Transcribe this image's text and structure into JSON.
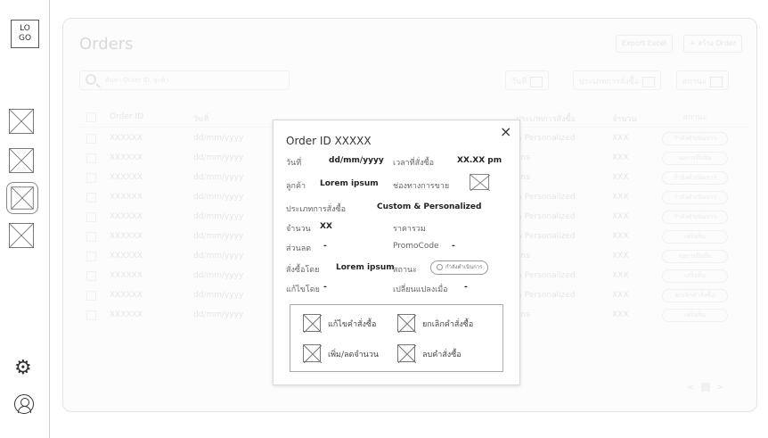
{
  "app": {
    "logo": "LO\nGO"
  },
  "sidebar": {
    "items": [
      {
        "icon": "placeholder-icon",
        "active": false
      },
      {
        "icon": "placeholder-icon",
        "active": false
      },
      {
        "icon": "placeholder-icon",
        "active": true
      },
      {
        "icon": "placeholder-icon",
        "active": false
      }
    ],
    "settings_icon": "gear-icon",
    "profile_icon": "user-icon"
  },
  "page": {
    "title": "Orders",
    "export_label": "Export Excel",
    "add_label": "+ สร้าง Order",
    "search_placeholder": "ค้นหา Order ID, ลูกค้า",
    "filters": [
      {
        "label": "วันที่"
      },
      {
        "label": "ประเภทการสั่งซื้อ"
      },
      {
        "label": "สถานะ"
      }
    ],
    "columns": {
      "id": "Order ID",
      "date": "วันที่",
      "type": "ประเภทการสั่งซื้อ",
      "qty": "จำนวน",
      "status": "สถานะ"
    },
    "rows": [
      {
        "id": "XXXXXX",
        "date": "dd/mm/yyyy",
        "type": "& Personalized",
        "qty": "XXX",
        "status": "กำลังดำเนินการ"
      },
      {
        "id": "XXXXXX",
        "date": "dd/mm/yyyy",
        "type": "ons",
        "qty": "XXX",
        "status": "รอการยืนยัน"
      },
      {
        "id": "XXXXXX",
        "date": "dd/mm/yyyy",
        "type": "ons",
        "qty": "XXX",
        "status": "กำลังดำเนินการ"
      },
      {
        "id": "XXXXXX",
        "date": "dd/mm/yyyy",
        "type": "& Personalized",
        "qty": "XXX",
        "status": "กำลังดำเนินการ"
      },
      {
        "id": "XXXXXX",
        "date": "dd/mm/yyyy",
        "type": "& Personalized",
        "qty": "XXX",
        "status": "กำลังดำเนินการ"
      },
      {
        "id": "XXXXXX",
        "date": "dd/mm/yyyy",
        "type": "& Personalized",
        "qty": "XXX",
        "status": "เสร็จสิ้น"
      },
      {
        "id": "XXXXXX",
        "date": "dd/mm/yyyy",
        "type": "ons",
        "qty": "XXX",
        "status": "รอการยืนยัน"
      },
      {
        "id": "XXXXXX",
        "date": "dd/mm/yyyy",
        "type": "& Personalized",
        "qty": "XXX",
        "status": "เสร็จสิ้น"
      },
      {
        "id": "XXXXXX",
        "date": "dd/mm/yyyy",
        "type": "& Personalized",
        "qty": "XXX",
        "status": "ยกเลิกคำสั่งซื้อ"
      },
      {
        "id": "XXXXXX",
        "date": "dd/mm/yyyy",
        "type": "ons",
        "qty": "XXX",
        "status": "เสร็จสิ้น"
      }
    ],
    "pager": {
      "prev": "<",
      "next": ">"
    }
  },
  "modal": {
    "title": "Order ID   XXXXX",
    "close": "×",
    "date_label": "วันที่",
    "date_value": "dd/mm/yyyy",
    "time_label": "เวลาที่สั่งซื้อ",
    "time_value": "XX.XX pm",
    "customer_label": "ลูกค้า",
    "customer_value": "Lorem ipsum",
    "channel_label": "ช่องทางการขาย",
    "type_label": "ประเภทการสั่งซื้อ",
    "type_value": "Custom & Personalized",
    "qty_label": "จำนวน",
    "qty_value": "XX",
    "total_label": "ราคารวม",
    "discount_label": "ส่วนลด",
    "discount_value": "-",
    "promo_label": "PromoCode",
    "promo_value": "-",
    "ordered_by_label": "สั่งซื้อโดย",
    "ordered_by_value": "Lorem ipsum",
    "status_label": "สถานะ",
    "status_value": "กำลังดำเนินการ",
    "edited_by_label": "แก้ไขโดย",
    "edited_by_value": "-",
    "changed_at_label": "เปลี่ยนแปลงเมื่อ",
    "changed_at_value": "-",
    "actions": {
      "edit": "แก้ไขคำสั่งซื้อ",
      "cancel": "ยกเลิกคำสั่งซื้อ",
      "adjust_qty": "เพิ่ม/ลดจำนวน",
      "delete": "ลบคำสั่งซื้อ"
    }
  }
}
